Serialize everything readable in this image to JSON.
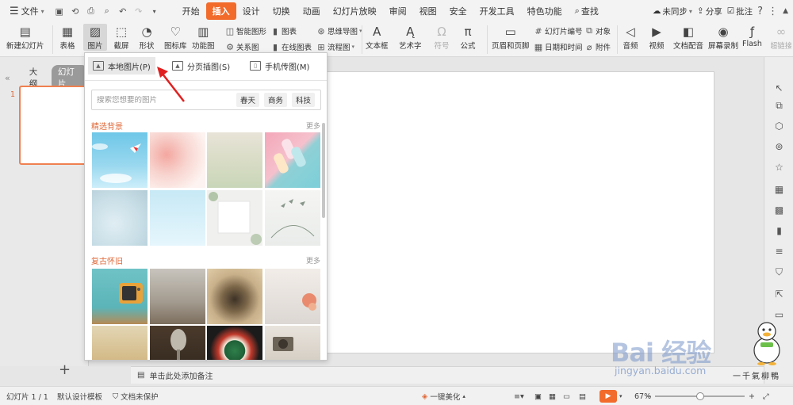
{
  "menubar": {
    "file_label": "文件",
    "tabs": [
      "开始",
      "插入",
      "设计",
      "切换",
      "动画",
      "幻灯片放映",
      "审阅",
      "视图",
      "安全",
      "开发工具",
      "特色功能"
    ],
    "search_label": "查找",
    "sync_label": "未同步",
    "share_label": "分享",
    "comment_label": "批注",
    "accent_color": "#f26b2b"
  },
  "ribbon": {
    "new_slide": "新建幻灯片",
    "table": "表格",
    "picture": "图片",
    "screenshot": "截屏",
    "shape": "形状",
    "icon_lib": "图标库",
    "func_chart": "功能图",
    "smart_shape": "智能图形",
    "relation": "关系图",
    "chart": "图表",
    "online_chart": "在线图表",
    "mind_map": "思维导图",
    "flowchart": "流程图",
    "textbox": "文本框",
    "art_text": "艺术字",
    "symbol": "符号",
    "formula": "公式",
    "header_footer": "页眉和页脚",
    "slide_num": "幻灯片编号",
    "object": "对象",
    "datetime": "日期和时间",
    "attachment": "附件",
    "audio": "音频",
    "video": "视频",
    "doc_dub": "文档配音",
    "screen_rec": "屏幕录制",
    "flash": "Flash",
    "hyperlink": "超链接"
  },
  "left_panel": {
    "tab_outline": "大纲",
    "tab_slides": "幻灯片",
    "slide_number": "1"
  },
  "dropdown": {
    "options": [
      "本地图片(P)",
      "分页插图(S)",
      "手机传图(M)"
    ],
    "search_placeholder": "搜索您想要的图片",
    "tags": [
      "春天",
      "商务",
      "科技"
    ],
    "sections": [
      {
        "title": "精选背景",
        "more": "更多"
      },
      {
        "title": "复古怀旧",
        "more": "更多"
      }
    ]
  },
  "notes": {
    "placeholder": "单击此处添加备注"
  },
  "statusbar": {
    "slide_info": "幻灯片 1 / 1",
    "template": "默认设计模板",
    "protect": "文档未保护",
    "beautify": "一键美化",
    "zoom": "67%"
  },
  "watermark": {
    "logo": "Bai 经验",
    "url": "jingyan.baidu.com",
    "author": "一千氣柳鴨"
  }
}
